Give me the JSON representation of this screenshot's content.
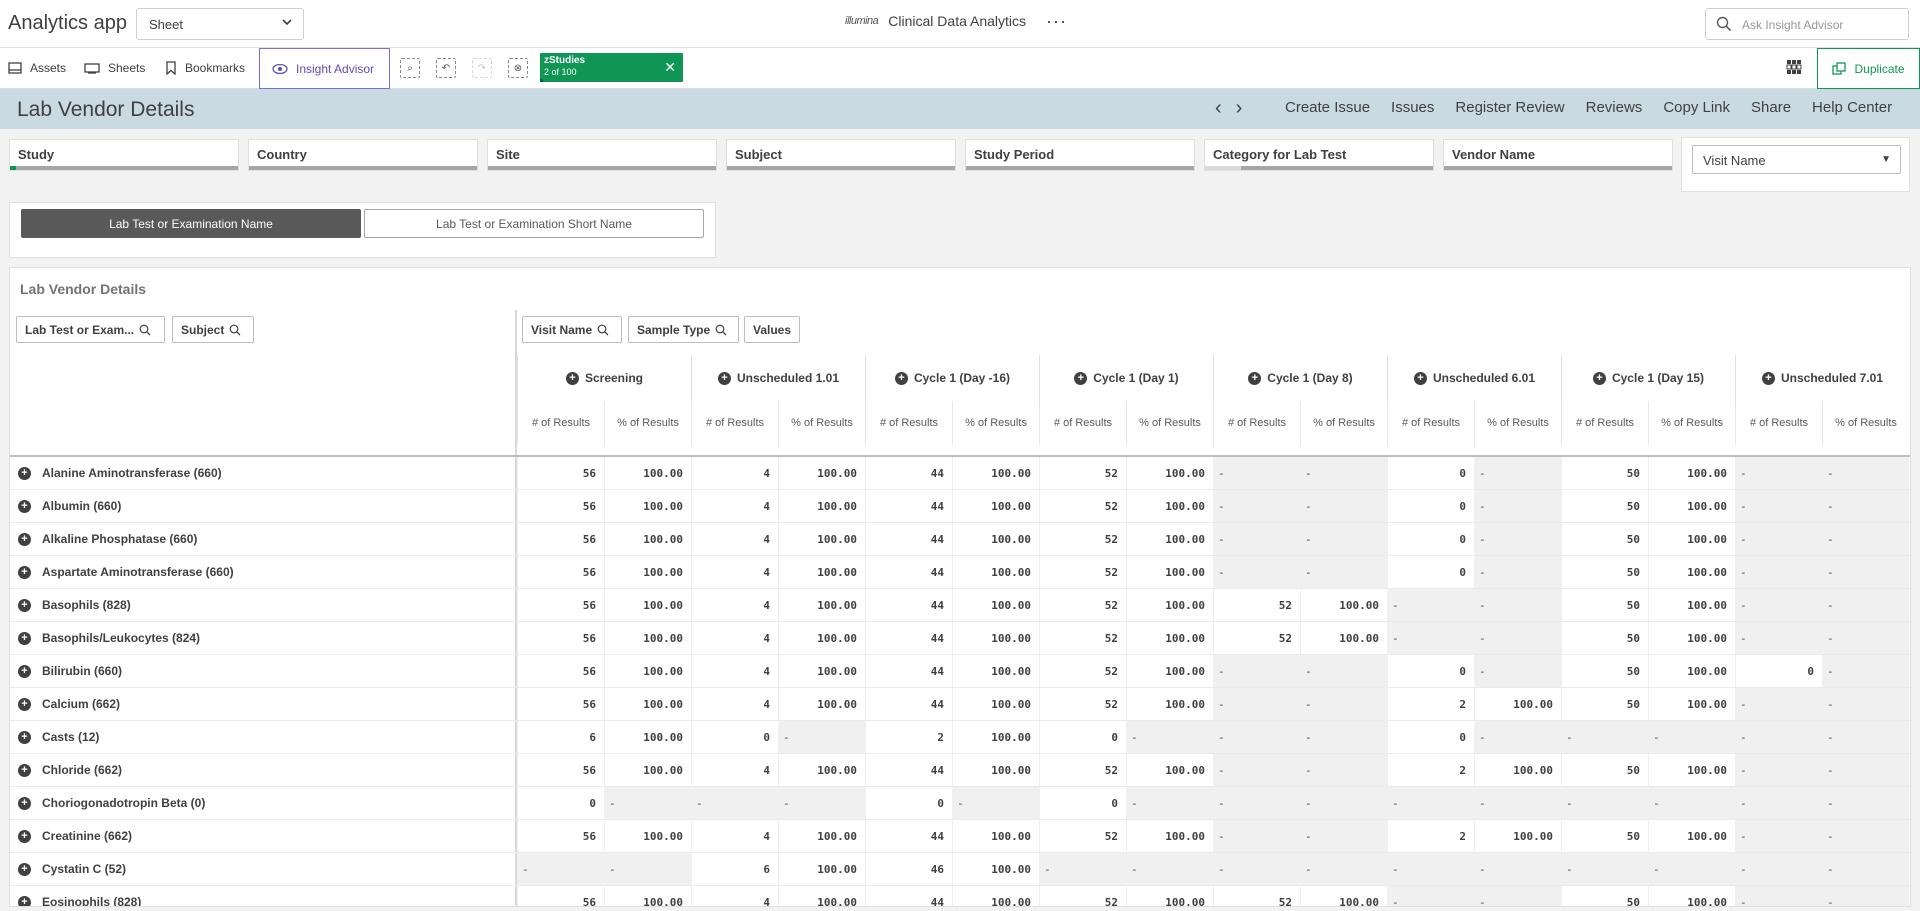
{
  "topbar": {
    "app_title": "Analytics app",
    "sheet_select": "Sheet",
    "brand_logo": "illumina",
    "brand_name": "Clinical Data Analytics",
    "more": "···",
    "ask_placeholder": "Ask Insight Advisor"
  },
  "toolbar": {
    "assets": "Assets",
    "sheets": "Sheets",
    "bookmarks": "Bookmarks",
    "insight_advisor": "Insight Advisor",
    "chip_title": "zStudies",
    "chip_count": "2 of 100",
    "chip_close": "✕",
    "duplicate": "Duplicate",
    "accent_color": "#109654"
  },
  "sheet_header": {
    "title": "Lab Vendor Details",
    "prev": "‹",
    "next": "›",
    "links": [
      "Create Issue",
      "Issues",
      "Register Review",
      "Reviews",
      "Copy Link",
      "Share",
      "Help Center"
    ]
  },
  "filters": {
    "boxes": [
      "Study",
      "Country",
      "Site",
      "Subject",
      "Study Period",
      "Category for Lab Test",
      "Vendor Name"
    ],
    "visit_dropdown": "Visit Name"
  },
  "buttons": {
    "active": "Lab Test or Examination Name",
    "inactive": "Lab Test or Examination Short Name"
  },
  "table": {
    "title": "Lab Vendor Details",
    "left_dims": [
      "Lab Test or Exam...",
      "Subject"
    ],
    "top_dims": [
      "Visit Name",
      "Sample Type",
      "Values"
    ],
    "visits": [
      "Screening",
      "Unscheduled 1.01",
      "Cycle 1 (Day -16)",
      "Cycle 1 (Day 1)",
      "Cycle 1 (Day 8)",
      "Unscheduled 6.01",
      "Cycle 1 (Day 15)",
      "Unscheduled 7.01"
    ],
    "measures": [
      "# of Results",
      "% of Results"
    ],
    "rows": [
      {
        "label": "Alanine Aminotransferase (660)",
        "cells": [
          "56",
          "100.00",
          "4",
          "100.00",
          "44",
          "100.00",
          "52",
          "100.00",
          "-",
          "-",
          "0",
          "-",
          "50",
          "100.00",
          "-",
          "-"
        ]
      },
      {
        "label": "Albumin (660)",
        "cells": [
          "56",
          "100.00",
          "4",
          "100.00",
          "44",
          "100.00",
          "52",
          "100.00",
          "-",
          "-",
          "0",
          "-",
          "50",
          "100.00",
          "-",
          "-"
        ]
      },
      {
        "label": "Alkaline Phosphatase (660)",
        "cells": [
          "56",
          "100.00",
          "4",
          "100.00",
          "44",
          "100.00",
          "52",
          "100.00",
          "-",
          "-",
          "0",
          "-",
          "50",
          "100.00",
          "-",
          "-"
        ]
      },
      {
        "label": "Aspartate Aminotransferase (660)",
        "cells": [
          "56",
          "100.00",
          "4",
          "100.00",
          "44",
          "100.00",
          "52",
          "100.00",
          "-",
          "-",
          "0",
          "-",
          "50",
          "100.00",
          "-",
          "-"
        ]
      },
      {
        "label": "Basophils (828)",
        "cells": [
          "56",
          "100.00",
          "4",
          "100.00",
          "44",
          "100.00",
          "52",
          "100.00",
          "52",
          "100.00",
          "-",
          "-",
          "50",
          "100.00",
          "-",
          "-"
        ]
      },
      {
        "label": "Basophils/Leukocytes (824)",
        "cells": [
          "56",
          "100.00",
          "4",
          "100.00",
          "44",
          "100.00",
          "52",
          "100.00",
          "52",
          "100.00",
          "-",
          "-",
          "50",
          "100.00",
          "-",
          "-"
        ]
      },
      {
        "label": "Bilirubin (660)",
        "cells": [
          "56",
          "100.00",
          "4",
          "100.00",
          "44",
          "100.00",
          "52",
          "100.00",
          "-",
          "-",
          "0",
          "-",
          "50",
          "100.00",
          "0",
          "-"
        ]
      },
      {
        "label": "Calcium (662)",
        "cells": [
          "56",
          "100.00",
          "4",
          "100.00",
          "44",
          "100.00",
          "52",
          "100.00",
          "-",
          "-",
          "2",
          "100.00",
          "50",
          "100.00",
          "-",
          "-"
        ]
      },
      {
        "label": "Casts (12)",
        "cells": [
          "6",
          "100.00",
          "0",
          "-",
          "2",
          "100.00",
          "0",
          "-",
          "-",
          "-",
          "0",
          "-",
          "-",
          "-",
          "-",
          "-"
        ]
      },
      {
        "label": "Chloride (662)",
        "cells": [
          "56",
          "100.00",
          "4",
          "100.00",
          "44",
          "100.00",
          "52",
          "100.00",
          "-",
          "-",
          "2",
          "100.00",
          "50",
          "100.00",
          "-",
          "-"
        ]
      },
      {
        "label": "Choriogonadotropin Beta (0)",
        "cells": [
          "0",
          "-",
          "-",
          "-",
          "0",
          "-",
          "0",
          "-",
          "-",
          "-",
          "-",
          "-",
          "-",
          "-",
          "-",
          "-"
        ]
      },
      {
        "label": "Creatinine (662)",
        "cells": [
          "56",
          "100.00",
          "4",
          "100.00",
          "44",
          "100.00",
          "52",
          "100.00",
          "-",
          "-",
          "2",
          "100.00",
          "50",
          "100.00",
          "-",
          "-"
        ]
      },
      {
        "label": "Cystatin C (52)",
        "cells": [
          "-",
          "-",
          "6",
          "100.00",
          "46",
          "100.00",
          "-",
          "-",
          "-",
          "-",
          "-",
          "-",
          "-",
          "-",
          "-",
          "-"
        ]
      },
      {
        "label": "Eosinophils (828)",
        "cells": [
          "56",
          "100.00",
          "4",
          "100.00",
          "44",
          "100.00",
          "52",
          "100.00",
          "52",
          "100.00",
          "-",
          "-",
          "50",
          "100.00",
          "-",
          "-"
        ]
      }
    ]
  }
}
